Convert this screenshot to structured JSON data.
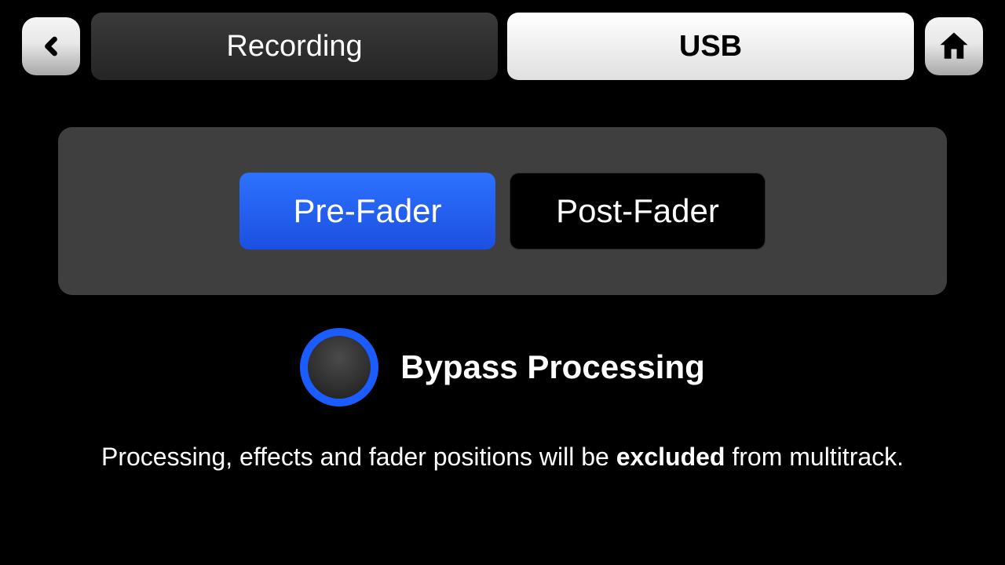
{
  "tabs": {
    "recording": "Recording",
    "usb": "USB"
  },
  "modes": {
    "pre_fader": "Pre-Fader",
    "post_fader": "Post-Fader"
  },
  "bypass": {
    "label": "Bypass Processing"
  },
  "description": {
    "prefix": "Processing, effects and fader positions will be ",
    "emphasis": "excluded",
    "suffix": " from multitrack."
  }
}
